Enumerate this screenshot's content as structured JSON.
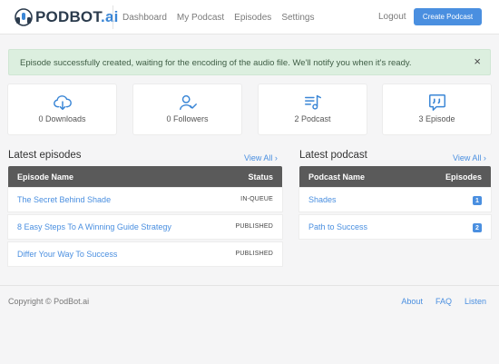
{
  "header": {
    "logo_word": "PODBOT",
    "logo_suffix": ".ai",
    "nav": [
      "Dashboard",
      "My Podcast",
      "Episodes",
      "Settings"
    ],
    "logout": "Logout",
    "create_button": "Create Podcast"
  },
  "alert": {
    "message": "Episode successfully created, waiting for the encoding of the audio file. We'll notify you when it's ready.",
    "close": "×"
  },
  "stats": [
    {
      "icon": "cloud-download-icon",
      "label": "0 Downloads"
    },
    {
      "icon": "user-check-icon",
      "label": "0 Followers"
    },
    {
      "icon": "playlist-music-icon",
      "label": "2 Podcast"
    },
    {
      "icon": "chat-quote-icon",
      "label": "3 Episode"
    }
  ],
  "episodes": {
    "title": "Latest episodes",
    "view_all": "View All",
    "col_name": "Episode Name",
    "col_status": "Status",
    "rows": [
      {
        "name": "The Secret Behind Shade",
        "status": "IN-QUEUE"
      },
      {
        "name": "8 Easy Steps To A Winning Guide Strategy",
        "status": "PUBLISHED"
      },
      {
        "name": "Differ Your Way To Success",
        "status": "PUBLISHED"
      }
    ]
  },
  "podcasts": {
    "title": "Latest podcast",
    "view_all": "View All",
    "col_name": "Podcast Name",
    "col_episodes": "Episodes",
    "rows": [
      {
        "name": "Shades",
        "episodes": "1"
      },
      {
        "name": "Path to Success",
        "episodes": "2"
      }
    ]
  },
  "footer": {
    "copyright": "Copyright © PodBot.ai",
    "links": [
      "About",
      "FAQ",
      "Listen"
    ]
  },
  "colors": {
    "accent": "#4a8fe0",
    "alert_bg": "#dcefdf",
    "table_header": "#5a5a5a"
  }
}
